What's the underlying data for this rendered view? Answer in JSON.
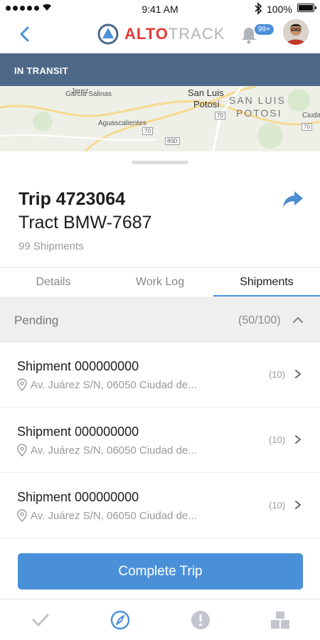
{
  "status_bar": {
    "time": "9:41 AM",
    "battery": "100%"
  },
  "header": {
    "logo_part1": "ALTO",
    "logo_part2": "TRACK",
    "notification_count": "99+"
  },
  "status_banner": "IN TRANSIT",
  "map": {
    "labels": [
      "San Luis",
      "Potosí",
      "SAN LUIS",
      "POTOSI",
      "Aguascalientes",
      "Garcia Salinas",
      "Jerez",
      "Ciuda"
    ],
    "route_shields": [
      "70",
      "70",
      "80D",
      "70"
    ]
  },
  "trip": {
    "title": "Trip 4723064",
    "vehicle": "Tract BMW-7687",
    "shipment_count": "99 Shipments"
  },
  "tabs": [
    {
      "label": "Details",
      "active": false
    },
    {
      "label": "Work Log",
      "active": false
    },
    {
      "label": "Shipments",
      "active": true
    }
  ],
  "section": {
    "label": "Pending",
    "count": "(50/100)"
  },
  "shipments": [
    {
      "title": "Shipment 000000000",
      "address": "Av. Juárez S/N, 06050 Ciudad de...",
      "count": "(10)"
    },
    {
      "title": "Shipment 000000000",
      "address": "Av. Juárez S/N, 06050 Ciudad de...",
      "count": "(10)"
    },
    {
      "title": "Shipment 000000000",
      "address": "Av. Juárez S/N, 06050 Ciudad de...",
      "count": "(10)"
    }
  ],
  "actions": {
    "complete_label": "Complete Trip"
  },
  "bottom_nav": [
    "check-icon",
    "compass-icon",
    "alert-icon",
    "boxes-icon"
  ],
  "colors": {
    "accent": "#4a90d9",
    "banner": "#4e6888",
    "brand_red": "#e53935"
  }
}
